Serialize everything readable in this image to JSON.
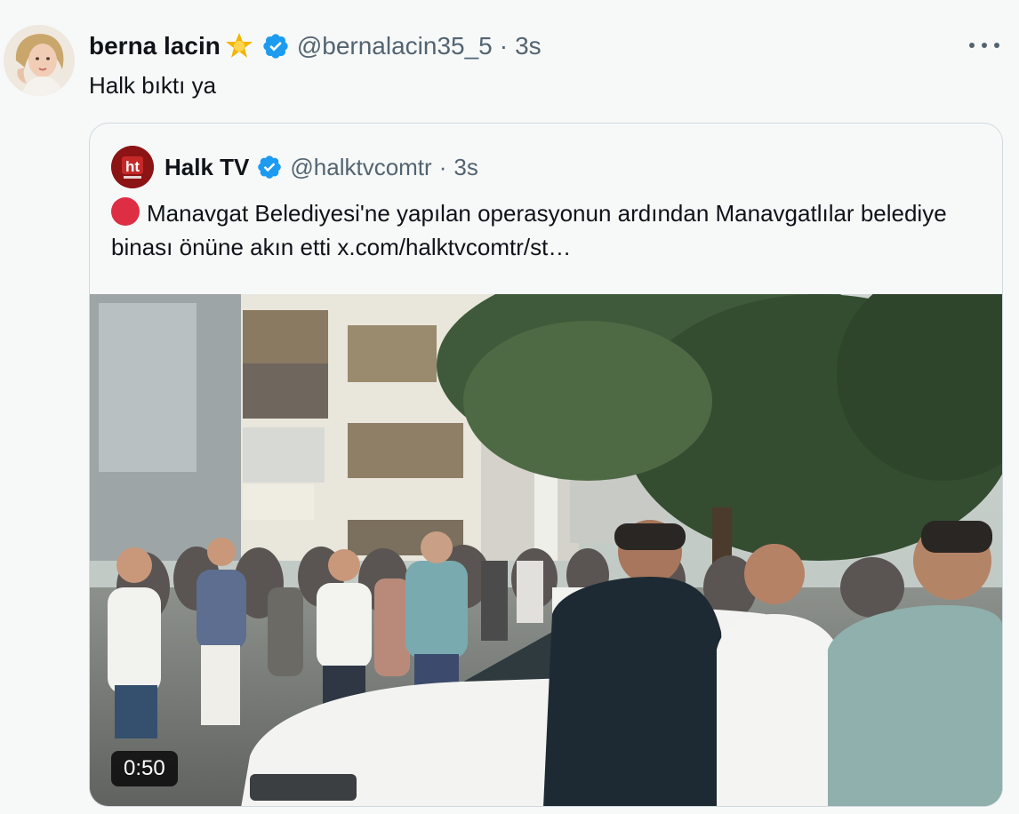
{
  "tweet": {
    "display_name": "berna lacin",
    "name_emoji": "star-emoji",
    "handle": "@bernalacin35_5",
    "separator": "·",
    "time": "3s",
    "text": "Halk bıktı ya",
    "more_label": "More"
  },
  "quote": {
    "display_name": "Halk TV",
    "handle": "@halktvcomtr",
    "separator": "·",
    "time": "3s",
    "text": "Manavgat Belediyesi'ne yapılan operasyonun ardından Manavgatlılar belediye binası önüne akın etti ",
    "link": "x.com/halktvcomtr/st…",
    "avatar_logo_text": "ht",
    "video": {
      "duration": "0:50"
    }
  },
  "colors": {
    "background": "#f7f9f9",
    "text": "#0f1419",
    "secondary_text": "#536471",
    "verified_blue": "#1d9bf0",
    "border": "#cfd9de",
    "halk_tv_red": "#8c1414",
    "red_circle": "#dd2e44"
  }
}
